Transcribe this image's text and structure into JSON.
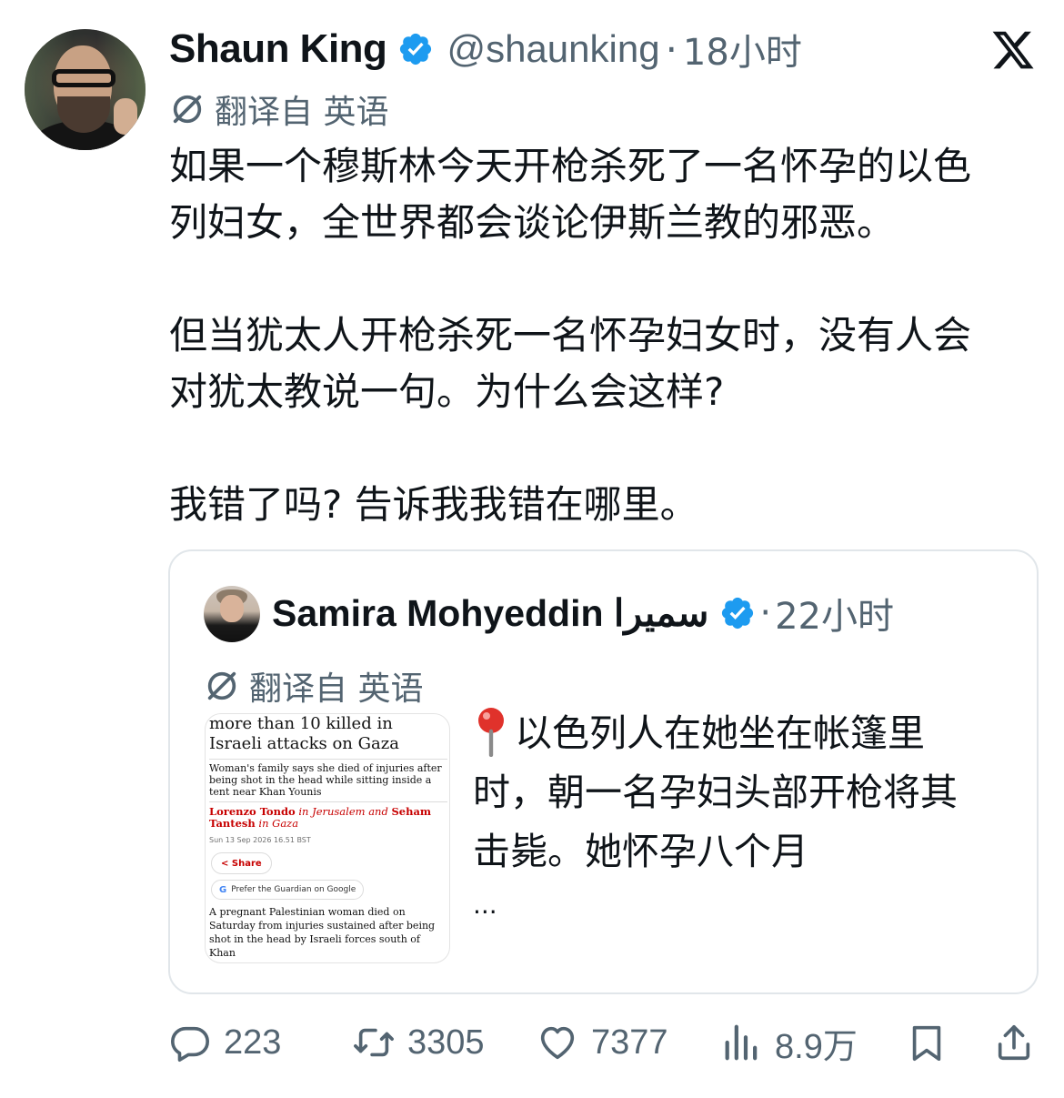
{
  "post": {
    "author_name": "Shaun King",
    "author_handle": "@shaunking",
    "separator": "·",
    "time": "18小时",
    "translate_label": "翻译自 英语",
    "text": "如果一个穆斯林今天开枪杀死了一名怀孕的以色\n列妇女，全世界都会谈论伊斯兰教的邪恶。\n\n但当犹太人开枪杀死一名怀孕妇女时，没有人会\n对犹太教说一句。为什么会这样?\n\n我错了吗? 告诉我我错在哪里。"
  },
  "quote": {
    "author_name": "Samira Mohyeddin سميرا",
    "separator": "·",
    "time": "22小时",
    "translate_label": "翻译自 英语",
    "text": "以色列人在她坐在帐篷里\n时，朝一名孕妇头部开枪将其\n击毙。她怀孕八个月",
    "ellipsis": "...",
    "article": {
      "headline": "more than 10 killed in Israeli attacks on Gaza",
      "standfirst": "Woman's family says she died of injuries after being shot in the head while sitting inside a tent near Khan Younis",
      "byline_author1": "Lorenzo Tondo",
      "byline_loc1": " in Jerusalem and ",
      "byline_author2": "Seham Tantesh",
      "byline_loc2": " in Gaza",
      "date": "Sun 13 Sep 2026 16.51 BST",
      "share_label": "Share",
      "prefer_label": "Prefer the Guardian on Google",
      "body": "A pregnant Palestinian woman died on Saturday from injuries sustained after being shot in the head by Israeli forces south of Khan"
    }
  },
  "actions": {
    "replies": "223",
    "reposts": "3305",
    "likes": "7377",
    "views": "8.9万"
  },
  "icons": {
    "verified": "verified-badge-icon",
    "x_logo": "x-logo-icon",
    "translate": "translate-icon",
    "pin": "pushpin-icon",
    "reply": "reply-icon",
    "repost": "repost-icon",
    "like": "heart-icon",
    "views": "views-chart-icon",
    "bookmark": "bookmark-icon",
    "share": "share-icon"
  },
  "colors": {
    "text": "#0f1419",
    "muted": "#536471",
    "verified": "#1d9bf0",
    "border": "#e1e6ea"
  }
}
